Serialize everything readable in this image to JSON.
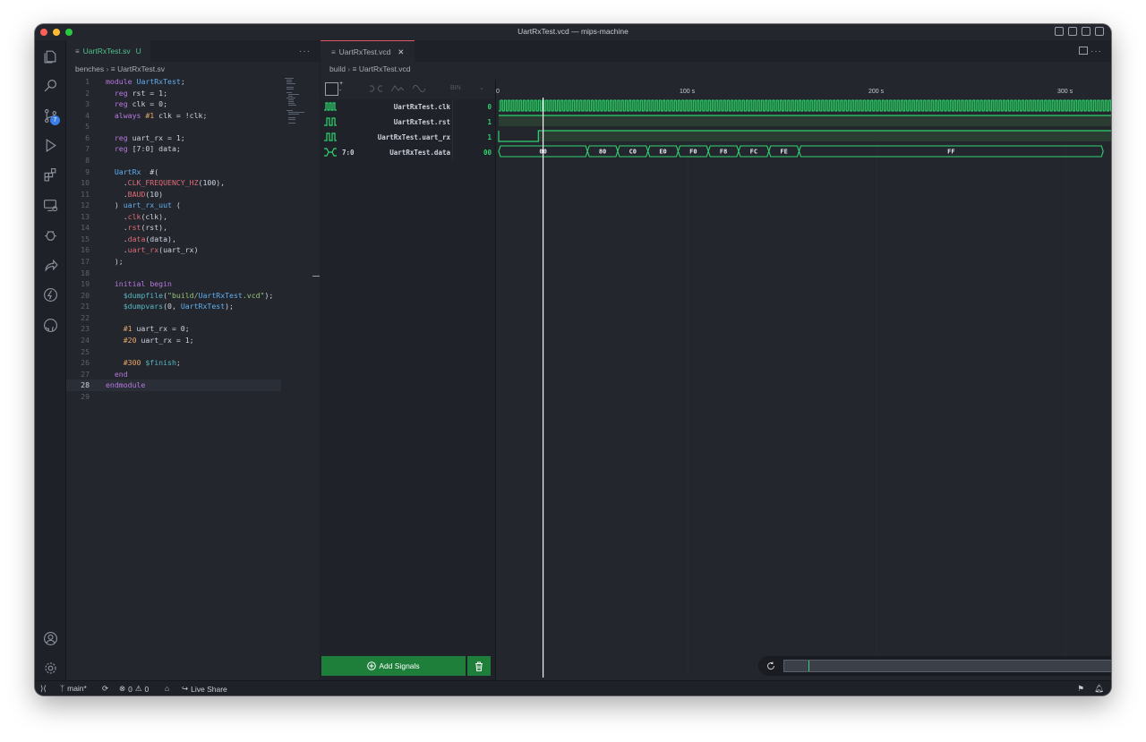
{
  "window": {
    "title": "UartRxTest.vcd — mips-machine"
  },
  "activity_bar": {
    "badge": "7"
  },
  "editor": {
    "tab": {
      "filename": "UartRxTest.sv",
      "status": "U"
    },
    "breadcrumb": {
      "folder": "benches",
      "file": "UartRxTest.sv"
    },
    "current_line": 28,
    "code_lines": [
      "module UartRxTest;",
      "  reg rst = 1;",
      "  reg clk = 0;",
      "  always #1 clk = !clk;",
      "",
      "  reg uart_rx = 1;",
      "  reg [7:0] data;",
      "",
      "  UartRx  #(",
      "    .CLK_FREQUENCY_HZ(100),",
      "    .BAUD(10)",
      "  ) uart_rx_uut (",
      "    .clk(clk),",
      "    .rst(rst),",
      "    .data(data),",
      "    .uart_rx(uart_rx)",
      "  );",
      "",
      "  initial begin",
      "    $dumpfile(\"build/UartRxTest.vcd\");",
      "    $dumpvars(0, UartRxTest);",
      "",
      "    #1 uart_rx = 0;",
      "    #20 uart_rx = 1;",
      "",
      "    #300 $finish;",
      "  end",
      "endmodule",
      ""
    ]
  },
  "waveform": {
    "tab": {
      "filename": "UartRxTest.vcd"
    },
    "breadcrumb": {
      "folder": "build",
      "file": "UartRxTest.vcd"
    },
    "toolbar": {
      "radix": "BIN"
    },
    "ruler": {
      "labels": [
        "0",
        "100 s",
        "200 s",
        "300 s"
      ]
    },
    "signals": [
      {
        "name": "UartRxTest.clk",
        "value": "0",
        "width": ""
      },
      {
        "name": "UartRxTest.rst",
        "value": "1",
        "width": ""
      },
      {
        "name": "UartRxTest.uart_rx",
        "value": "1",
        "width": ""
      },
      {
        "name": "UartRxTest.data",
        "value": "00",
        "width": "7:0"
      }
    ],
    "data_segments": [
      {
        "value": "00",
        "start": 0,
        "end": 47
      },
      {
        "value": "80",
        "start": 47,
        "end": 63
      },
      {
        "value": "C0",
        "start": 63,
        "end": 79
      },
      {
        "value": "E0",
        "start": 79,
        "end": 95
      },
      {
        "value": "F0",
        "start": 95,
        "end": 111
      },
      {
        "value": "F8",
        "start": 111,
        "end": 127
      },
      {
        "value": "FC",
        "start": 127,
        "end": 143
      },
      {
        "value": "FE",
        "start": 143,
        "end": 159
      },
      {
        "value": "FF",
        "start": 159,
        "end": 320
      }
    ],
    "add_signals_label": "Add Signals",
    "colors": {
      "wave": "#2fd46f",
      "wave_dark": "#1d7f3a"
    }
  },
  "statusbar": {
    "branch": "main*",
    "errors": "0",
    "warnings": "0",
    "live_share": "Live Share"
  }
}
